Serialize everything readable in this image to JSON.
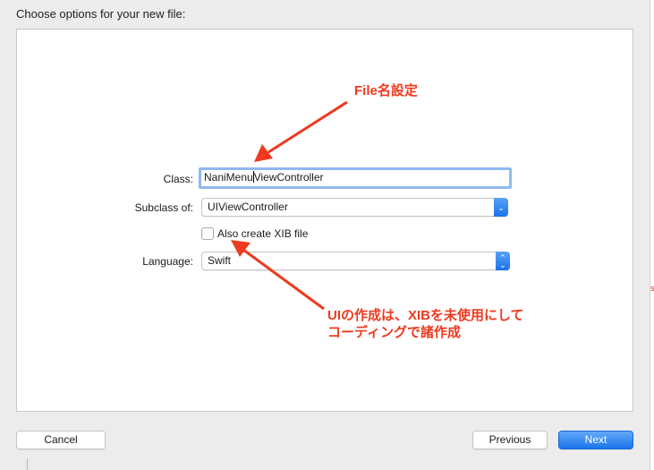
{
  "dialog": {
    "title": "Choose options for your new file:"
  },
  "form": {
    "class_label": "Class:",
    "class_value_before_caret": "NaniMenu",
    "class_value_after_caret": "ViewController",
    "subclass_label": "Subclass of:",
    "subclass_value": "UIViewController",
    "xib_checkbox_label": "Also create XIB file",
    "xib_checked": false,
    "language_label": "Language:",
    "language_value": "Swift"
  },
  "annotations": {
    "file_name_note": "File名設定",
    "ui_note_line1": "UIの作成は、XIBを未使用にして",
    "ui_note_line2": "コーディングで諸作成",
    "color": "#ee3a1f"
  },
  "buttons": {
    "cancel": "Cancel",
    "previous": "Previous",
    "next": "Next"
  },
  "colors": {
    "accent": "#1b74ea",
    "annotation": "#ee3a1f"
  }
}
